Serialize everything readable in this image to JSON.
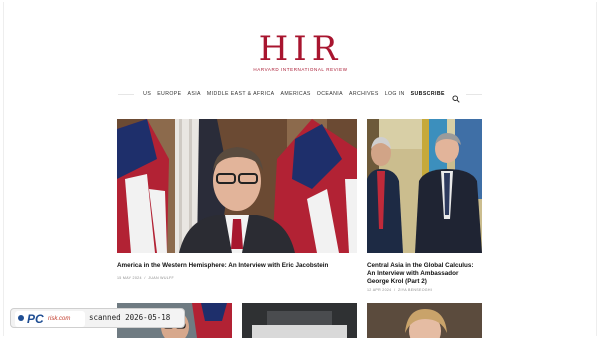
{
  "logo": {
    "mark": "HIR",
    "subtitle": "HARVARD INTERNATIONAL REVIEW"
  },
  "nav": {
    "items": [
      "US",
      "EUROPE",
      "ASIA",
      "MIDDLE EAST & AFRICA",
      "AMERICAS",
      "OCEANIA",
      "ARCHIVES",
      "LOG IN",
      "SUBSCRIBE"
    ],
    "search_icon": "search-icon"
  },
  "articles": [
    {
      "title": "America in the Western Hemisphere: An Interview with Eric Jacobstein",
      "date": "15 MAY 2024",
      "author": "JUAN WULFF"
    },
    {
      "title": "Central Asia in the Global Calculus: An Interview with Ambassador George Krol (Part 2)",
      "date": "12 APR 2024",
      "author": "ZIYA BENSEOGHI"
    }
  ],
  "watermark": {
    "brand_main": "PC",
    "brand_sub": "risk.com",
    "text": "scanned 2026-05-18"
  },
  "colors": {
    "brand": "#a8152f",
    "text": "#111111"
  }
}
